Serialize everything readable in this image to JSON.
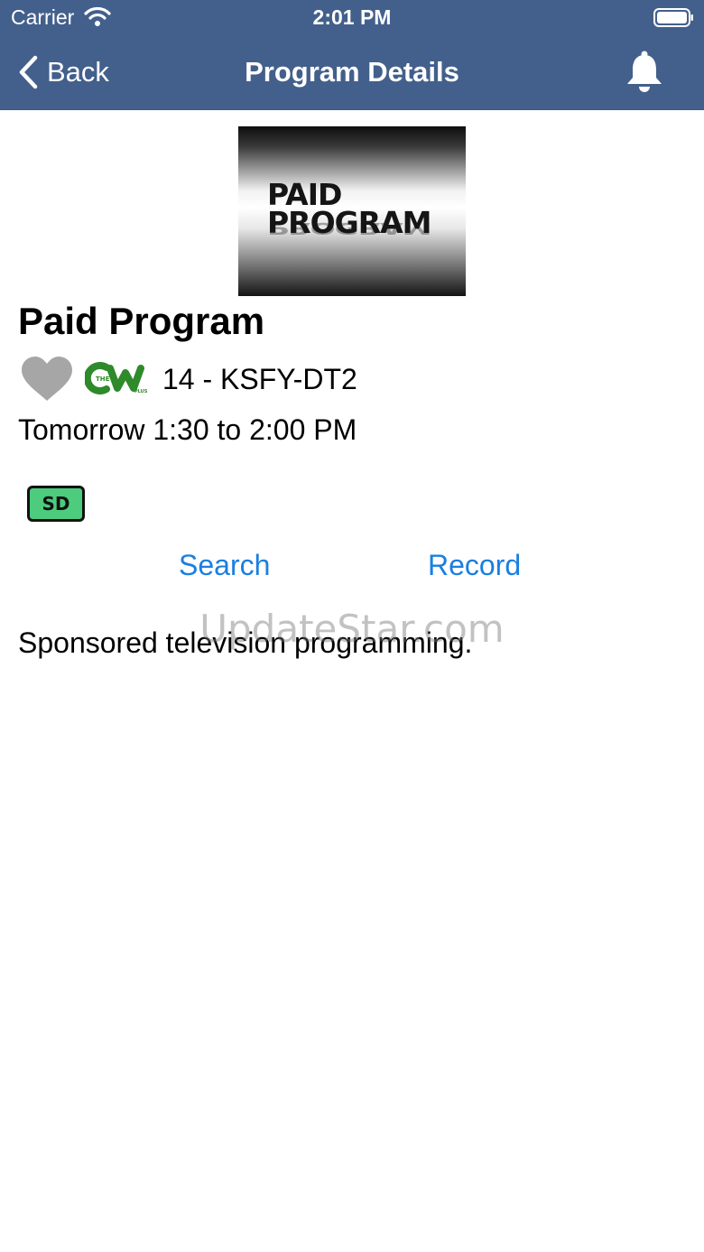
{
  "status_bar": {
    "carrier": "Carrier",
    "time": "2:01 PM"
  },
  "nav": {
    "back_label": "Back",
    "title": "Program Details"
  },
  "artwork": {
    "line1": "PAID",
    "line2": "PROGRAM"
  },
  "program": {
    "title": "Paid Program",
    "network_logo": "THE CW PLUS",
    "channel": "14 - KSFY-DT2",
    "airtime": "Tomorrow 1:30 to 2:00 PM",
    "format_badge": "SD",
    "description": "Sponsored television programming."
  },
  "actions": {
    "search_label": "Search",
    "record_label": "Record"
  },
  "watermark": "UpdateStar.com",
  "icons": [
    "wifi-icon",
    "battery-icon",
    "back-chevron-icon",
    "bell-icon",
    "heart-icon",
    "cw-plus-logo"
  ],
  "colors": {
    "nav_bar": "#43608c",
    "link": "#1a7fe0",
    "sd_badge": "#4ccc7c",
    "favorite_heart": "#a6a6a6",
    "cw_logo": "#2e8a2a"
  }
}
